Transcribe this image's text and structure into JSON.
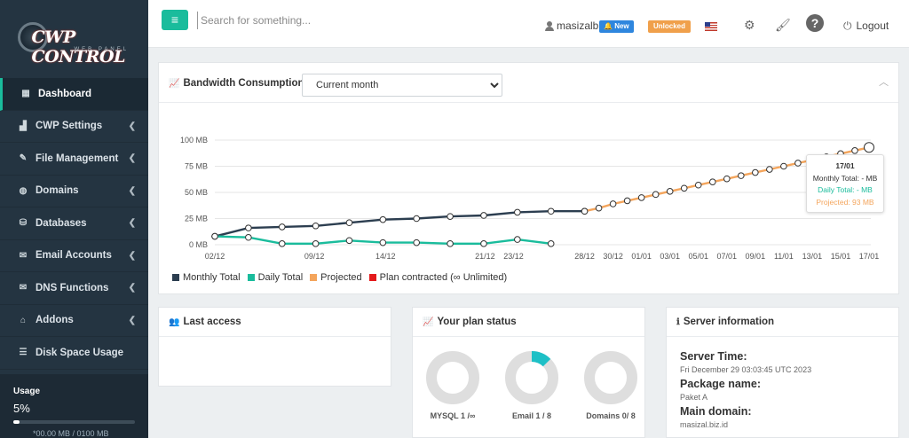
{
  "sidebar": {
    "logo_text": "CWP CONTROL",
    "logo_sub": "WEB PANEL",
    "items": [
      {
        "label": "Dashboard",
        "icon": "dashboard-icon",
        "active": true,
        "has_submenu": false
      },
      {
        "label": "CWP Settings",
        "icon": "bar-chart-icon",
        "active": false,
        "has_submenu": true
      },
      {
        "label": "File Management",
        "icon": "edit-icon",
        "active": false,
        "has_submenu": true
      },
      {
        "label": "Domains",
        "icon": "globe-icon",
        "active": false,
        "has_submenu": true
      },
      {
        "label": "Databases",
        "icon": "database-icon",
        "active": false,
        "has_submenu": true
      },
      {
        "label": "Email Accounts",
        "icon": "envelope-icon",
        "active": false,
        "has_submenu": true
      },
      {
        "label": "DNS Functions",
        "icon": "envelope-icon",
        "active": false,
        "has_submenu": true
      },
      {
        "label": "Addons",
        "icon": "bank-icon",
        "active": false,
        "has_submenu": true
      },
      {
        "label": "Disk Space Usage",
        "icon": "tasks-icon",
        "active": false,
        "has_submenu": false
      }
    ],
    "usage": {
      "title": "Usage",
      "percent_label": "5%",
      "fraction": 0.05,
      "detail": "*00.00 MB / 0100 MB"
    }
  },
  "topbar": {
    "search_placeholder": "Search for something...",
    "username": "masizalb",
    "new_badge": "New",
    "unlocked_badge": "Unlocked",
    "logout_label": "Logout"
  },
  "bandwidth": {
    "title": "Bandwidth Consumption",
    "period_selected": "Current month",
    "tooltip": {
      "date": "17/01",
      "monthly": "Monthly Total: - MB",
      "daily": "Daily Total: - MB",
      "projected": "Projected: 93 MB"
    }
  },
  "chart_data": {
    "type": "line",
    "x": [
      "02/12",
      "03/12",
      "04/12",
      "05/12",
      "06/12",
      "07/12",
      "08/12",
      "09/12",
      "10/12",
      "11/12",
      "12/12",
      "13/12",
      "14/12",
      "15/12",
      "16/12",
      "17/12",
      "18/12",
      "19/12",
      "20/12",
      "21/12",
      "22/12",
      "23/12",
      "24/12",
      "25/12",
      "26/12",
      "27/12",
      "28/12",
      "29/12",
      "30/12",
      "31/12",
      "01/01",
      "02/01",
      "03/01",
      "04/01",
      "05/01",
      "06/01",
      "07/01",
      "08/01",
      "09/01",
      "10/01",
      "11/01",
      "12/01",
      "13/01",
      "14/01",
      "15/01",
      "16/01",
      "17/01"
    ],
    "tick_labels": [
      "02/12",
      "09/12",
      "14/12",
      "21/12",
      "23/12",
      "28/12",
      "30/12",
      "01/01",
      "03/01",
      "05/01",
      "07/01",
      "09/01",
      "11/01",
      "13/01",
      "15/01",
      "17/01"
    ],
    "y_ticks": [
      "0 MB",
      "25 MB",
      "50 MB",
      "75 MB",
      "100 MB"
    ],
    "ylim": [
      0,
      100
    ],
    "series": [
      {
        "name": "Monthly Total",
        "color": "#2c3e50",
        "points": [
          [
            0,
            8
          ],
          [
            1,
            16
          ],
          [
            2,
            17
          ],
          [
            3,
            18
          ],
          [
            4,
            21
          ],
          [
            5,
            24
          ],
          [
            6,
            25
          ],
          [
            7,
            27
          ],
          [
            8,
            28
          ],
          [
            9,
            31
          ],
          [
            10,
            32
          ],
          [
            11,
            32
          ]
        ]
      },
      {
        "name": "Daily Total",
        "color": "#1abc9c",
        "points": [
          [
            0,
            8
          ],
          [
            1,
            7
          ],
          [
            2,
            1
          ],
          [
            3,
            1
          ],
          [
            4,
            4
          ],
          [
            5,
            2
          ],
          [
            6,
            2
          ],
          [
            7,
            1
          ],
          [
            8,
            1
          ],
          [
            9,
            5
          ],
          [
            10,
            1
          ]
        ]
      },
      {
        "name": "Projected",
        "color": "#f4a55c",
        "points": [
          [
            11,
            32
          ],
          [
            12,
            35
          ],
          [
            13,
            39
          ],
          [
            14,
            42
          ],
          [
            15,
            45
          ],
          [
            16,
            48
          ],
          [
            17,
            51
          ],
          [
            18,
            54
          ],
          [
            19,
            57
          ],
          [
            20,
            60
          ],
          [
            21,
            63
          ],
          [
            22,
            66
          ],
          [
            23,
            69
          ],
          [
            24,
            72
          ],
          [
            25,
            75
          ],
          [
            26,
            78
          ],
          [
            27,
            81
          ],
          [
            28,
            84
          ],
          [
            29,
            87
          ],
          [
            30,
            90
          ],
          [
            31,
            93
          ]
        ]
      },
      {
        "name": "Plan contracted (∞ Unlimited)",
        "color": "#e41a1c",
        "points": []
      }
    ],
    "legend_placement": "bottom-left",
    "grid": true
  },
  "last_access": {
    "title": "Last access"
  },
  "plan_status": {
    "title": "Your plan status",
    "items": [
      {
        "label": "MYSQL 1 /∞",
        "fraction": 0.0
      },
      {
        "label": "Email 1 / 8",
        "fraction": 0.125
      },
      {
        "label": "Domains 0/ 8",
        "fraction": 0.0
      }
    ]
  },
  "server_info": {
    "title": "Server information",
    "rows": [
      {
        "k": "Server Time:",
        "v": "Fri December 29 03:03:45 UTC 2023"
      },
      {
        "k": "Package name:",
        "v": "Paket A"
      },
      {
        "k": "Main domain:",
        "v": "masizal.biz.id"
      }
    ]
  }
}
